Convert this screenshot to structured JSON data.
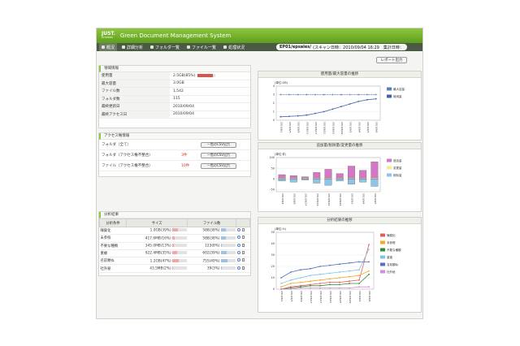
{
  "header": {
    "logo": "JUST.",
    "logo_sub": "SYSTEMS",
    "title": "Green Document Management System"
  },
  "nav": {
    "items": [
      {
        "label": "概況",
        "icon": "home-icon"
      },
      {
        "label": "詳細分析",
        "icon": "search-icon"
      },
      {
        "label": "フォルダ一覧",
        "icon": "folder-icon"
      },
      {
        "label": "ファイル一覧",
        "icon": "file-icon"
      },
      {
        "label": "処理状況",
        "icon": "status-icon"
      }
    ],
    "scan_path": "EP01/epsales/",
    "scan_info": "(スキャン日時：2010/09/04 16:29　集計日時："
  },
  "report_button": "レポート出力",
  "domain_info": {
    "title": "領域情報",
    "rows": [
      {
        "label": "使用量",
        "value": "2.5GB(85%)",
        "bar_percent": 85
      },
      {
        "label": "最大容量",
        "value": "3.0GB"
      },
      {
        "label": "ファイル数",
        "value": "1,542"
      },
      {
        "label": "フォルダ数",
        "value": "115"
      },
      {
        "label": "最終更新日",
        "value": "2010/09/04"
      },
      {
        "label": "最終アクセス日",
        "value": "2010/09/04"
      }
    ]
  },
  "access_info": {
    "title": "アクセス権情報",
    "rows": [
      {
        "label": "フォルダ（全て）",
        "count": "",
        "button": "一覧のCSV出力"
      },
      {
        "label": "フォルダ（アクセス権不整合）",
        "count": "3件",
        "button": "一覧のCSV出力"
      },
      {
        "label": "ファイル（アクセス権不整合）",
        "count": "10件",
        "button": "一覧のCSV出力"
      }
    ]
  },
  "analysis": {
    "title": "分析結果",
    "headers": [
      "分析条件",
      "サイズ",
      "ファイル数"
    ],
    "rows": [
      {
        "cond": "陳腐化",
        "size": "1.0GB(39%)",
        "size_pct": 39,
        "files": "588(38%)",
        "files_pct": 38
      },
      {
        "cond": "未参照",
        "size": "417.6MB(16%)",
        "size_pct": 16,
        "files": "588(38%)",
        "files_pct": 38
      },
      {
        "cond": "不要な種類",
        "size": "345.0MB(13%)",
        "size_pct": 13,
        "files": "123(8%)",
        "files_pct": 8
      },
      {
        "cond": "重複",
        "size": "922.4MB(35%)",
        "size_pct": 35,
        "files": "602(39%)",
        "files_pct": 39
      },
      {
        "cond": "名前類似",
        "size": "1.2GB(47%)",
        "size_pct": 47,
        "files": "755(49%)",
        "files_pct": 49
      },
      {
        "cond": "社外秘",
        "size": "43.5MB(2%)",
        "size_pct": 2,
        "files": "39(3%)",
        "files_pct": 3
      }
    ]
  },
  "colors": {
    "accent": "#8dc63f",
    "bar_red": "#d9534f",
    "bar_blue": "#9fc2e0",
    "bar_pink": "#f0a7a7"
  },
  "chart_data": [
    {
      "type": "line",
      "title": "使用量/最大容量の推移",
      "ylabel": "(単位:GB)",
      "ylim": [
        0,
        4
      ],
      "yticks": [
        "4",
        "3",
        "2",
        "1",
        "0"
      ],
      "categories": [
        "2010/8/1",
        "2010/8/5",
        "2010/8/9",
        "2010/8/13",
        "2010/8/17",
        "2010/8/21",
        "2010/8/25",
        "2010/8/29",
        "2010/9/2",
        "2010/9/4",
        "2010/9/5",
        "2010/9/6"
      ],
      "series": [
        {
          "name": "最大容量",
          "color": "#5a7fbf",
          "values": [
            3,
            3,
            3,
            3,
            3,
            3,
            3,
            3,
            3,
            3,
            3,
            3
          ]
        },
        {
          "name": "使用量",
          "color": "#3d62a8",
          "values": [
            0.4,
            0.45,
            0.5,
            0.6,
            0.8,
            1.0,
            1.3,
            1.6,
            1.9,
            2.2,
            2.4,
            2.5
          ]
        }
      ],
      "legend": "right"
    },
    {
      "type": "bar",
      "title": "追加量/削除量/変更量の推移",
      "ylabel": "(単位:件)",
      "ylim": [
        -60,
        100
      ],
      "yticks": [
        "100",
        "50",
        "0",
        "-50"
      ],
      "categories": [
        "2010/8/4",
        "2010/8/9",
        "2010/8/14",
        "2010/8/19",
        "2010/8/24",
        "2010/8/29",
        "2010/9/3",
        "2010/9/4",
        "2010/9/5"
      ],
      "series": [
        {
          "name": "追加量",
          "color": "#d676c8",
          "values": [
            20,
            15,
            10,
            30,
            45,
            25,
            60,
            40,
            80
          ]
        },
        {
          "name": "変更量",
          "color": "#f3ee8a",
          "values": [
            5,
            8,
            4,
            10,
            12,
            6,
            15,
            10,
            20
          ]
        },
        {
          "name": "削除量",
          "color": "#8ec3ea",
          "values": [
            -10,
            -15,
            -5,
            -20,
            -30,
            -10,
            -25,
            -15,
            -35
          ]
        }
      ],
      "legend": "right"
    },
    {
      "type": "line",
      "title": "分析結果の推移",
      "ylabel": "(単位:%)",
      "ylim": [
        0,
        50
      ],
      "yticks": [
        "50",
        "40",
        "30",
        "20",
        "10",
        "0"
      ],
      "categories": [
        "2010/8/1",
        "2010/8/5",
        "2010/8/9",
        "2010/8/13",
        "2010/8/17",
        "2010/8/21",
        "2010/8/25",
        "2010/8/29",
        "2010/9/2",
        "2010/9/4"
      ],
      "series": [
        {
          "name": "陳腐化",
          "color": "#e35d5d",
          "values": [
            0,
            2,
            3,
            4,
            5,
            6,
            6,
            7,
            8,
            39
          ]
        },
        {
          "name": "未参照",
          "color": "#f5a623",
          "values": [
            2,
            5,
            6,
            7,
            8,
            9,
            10,
            11,
            12,
            16
          ]
        },
        {
          "name": "不要な種類",
          "color": "#2e8b3d",
          "values": [
            0,
            1,
            2,
            3,
            3,
            4,
            4,
            5,
            5,
            13
          ]
        },
        {
          "name": "重複",
          "color": "#7fc4e8",
          "values": [
            5,
            8,
            10,
            12,
            13,
            14,
            15,
            16,
            17,
            35
          ]
        },
        {
          "name": "名前類似",
          "color": "#5a6fc0",
          "values": [
            10,
            15,
            17,
            18,
            20,
            21,
            22,
            23,
            24,
            24
          ]
        },
        {
          "name": "社外秘",
          "color": "#d58fd8",
          "values": [
            0,
            0,
            1,
            1,
            1,
            1,
            1,
            1,
            2,
            2
          ]
        }
      ],
      "legend": "right"
    }
  ]
}
